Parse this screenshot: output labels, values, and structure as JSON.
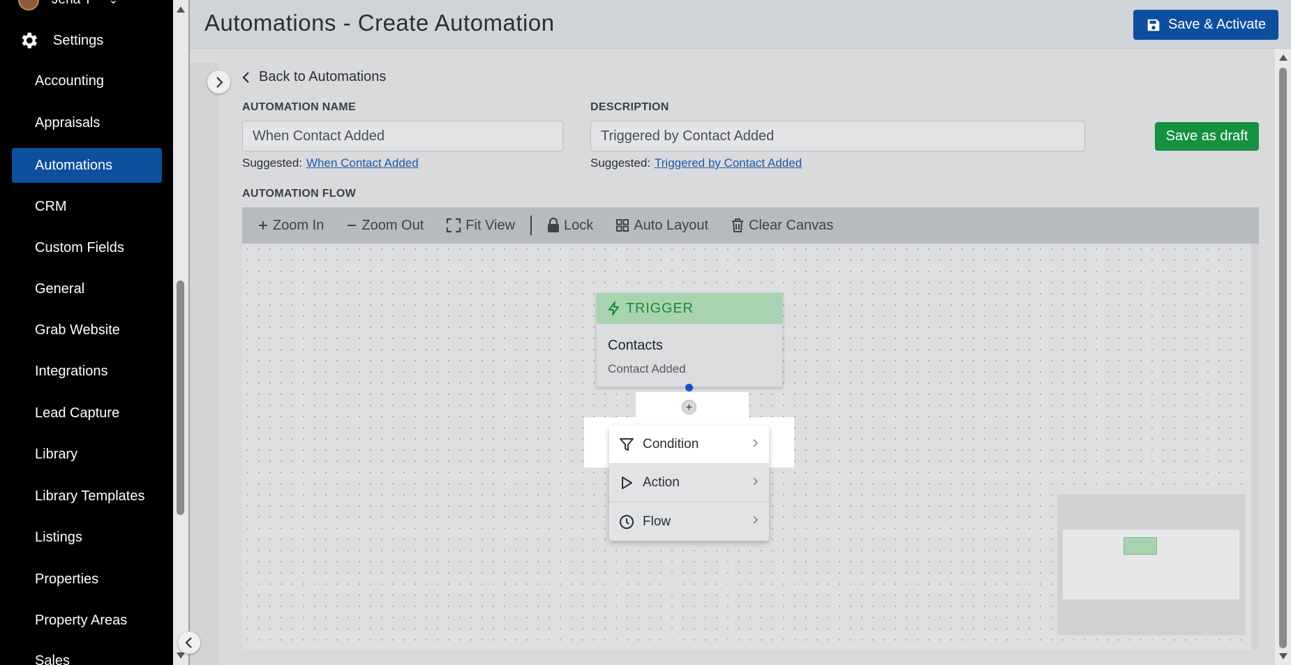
{
  "sidebar": {
    "user_name": "Jena T",
    "settings_label": "Settings",
    "items": [
      {
        "label": "Accounting"
      },
      {
        "label": "Appraisals"
      },
      {
        "label": "Automations"
      },
      {
        "label": "CRM"
      },
      {
        "label": "Custom Fields"
      },
      {
        "label": "General"
      },
      {
        "label": "Grab Website"
      },
      {
        "label": "Integrations"
      },
      {
        "label": "Lead Capture"
      },
      {
        "label": "Library"
      },
      {
        "label": "Library Templates"
      },
      {
        "label": "Listings"
      },
      {
        "label": "Properties"
      },
      {
        "label": "Property Areas"
      },
      {
        "label": "Sales"
      }
    ],
    "active_item": "Automations"
  },
  "header": {
    "title": "Automations - Create Automation",
    "save_activate_label": "Save & Activate"
  },
  "form": {
    "back_label": "Back to Automations",
    "name_label": "AUTOMATION NAME",
    "name_value": "When Contact Added",
    "name_suggested_prefix": "Suggested:",
    "name_suggested": "When Contact Added",
    "description_label": "DESCRIPTION",
    "description_value": "Triggered by Contact Added",
    "description_suggested_prefix": "Suggested:",
    "description_suggested": "Triggered by Contact Added",
    "save_draft_label": "Save as draft",
    "flow_label": "AUTOMATION FLOW"
  },
  "toolbar": {
    "zoom_in": "Zoom In",
    "zoom_out": "Zoom Out",
    "fit_view": "Fit View",
    "lock": "Lock",
    "auto_layout": "Auto Layout",
    "clear_canvas": "Clear Canvas"
  },
  "canvas": {
    "trigger": {
      "header": "TRIGGER",
      "title": "Contacts",
      "subtitle": "Contact Added"
    },
    "add_symbol": "+",
    "menu": [
      {
        "label": "Condition",
        "icon": "filter-icon"
      },
      {
        "label": "Action",
        "icon": "play-icon"
      },
      {
        "label": "Flow",
        "icon": "clock-icon"
      }
    ]
  },
  "colors": {
    "primary": "#0d4f9e",
    "success": "#15913f",
    "trigger_bg": "#a8d3b1",
    "trigger_text": "#1b8a3a",
    "sidebar_bg": "#000000"
  }
}
